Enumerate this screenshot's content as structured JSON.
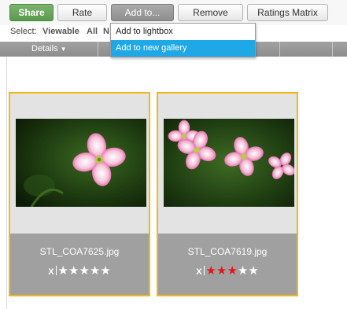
{
  "toolbar": {
    "share_label": "Share",
    "rate_label": "Rate",
    "add_to_label": "Add to...",
    "remove_label": "Remove",
    "ratings_matrix_label": "Ratings Matrix"
  },
  "selectbar": {
    "select_label": "Select:",
    "viewable_label": "Viewable",
    "all_label": "All",
    "none_label": "N"
  },
  "columns": {
    "details_label": "Details",
    "details_caret": "▼"
  },
  "add_to_menu": {
    "items": [
      {
        "label": "Add to lightbox"
      },
      {
        "label": "Add to new gallery"
      }
    ]
  },
  "gallery": {
    "items": [
      {
        "filename": "STL_COA7625.jpg",
        "reject_glyph": "X",
        "rating": 0,
        "max_rating": 5
      },
      {
        "filename": "STL_COA7619.jpg",
        "reject_glyph": "X",
        "rating": 3,
        "max_rating": 5
      }
    ]
  },
  "colors": {
    "share_green": "#5a9a4c",
    "selection_border": "#f4b61c",
    "menu_highlight": "#1ea8e6",
    "star_on": "#e8141c",
    "star_off": "#ffffff"
  },
  "icons": {
    "details_caret": "caret-down-icon",
    "reject": "reject-x-icon",
    "star": "star-icon"
  }
}
